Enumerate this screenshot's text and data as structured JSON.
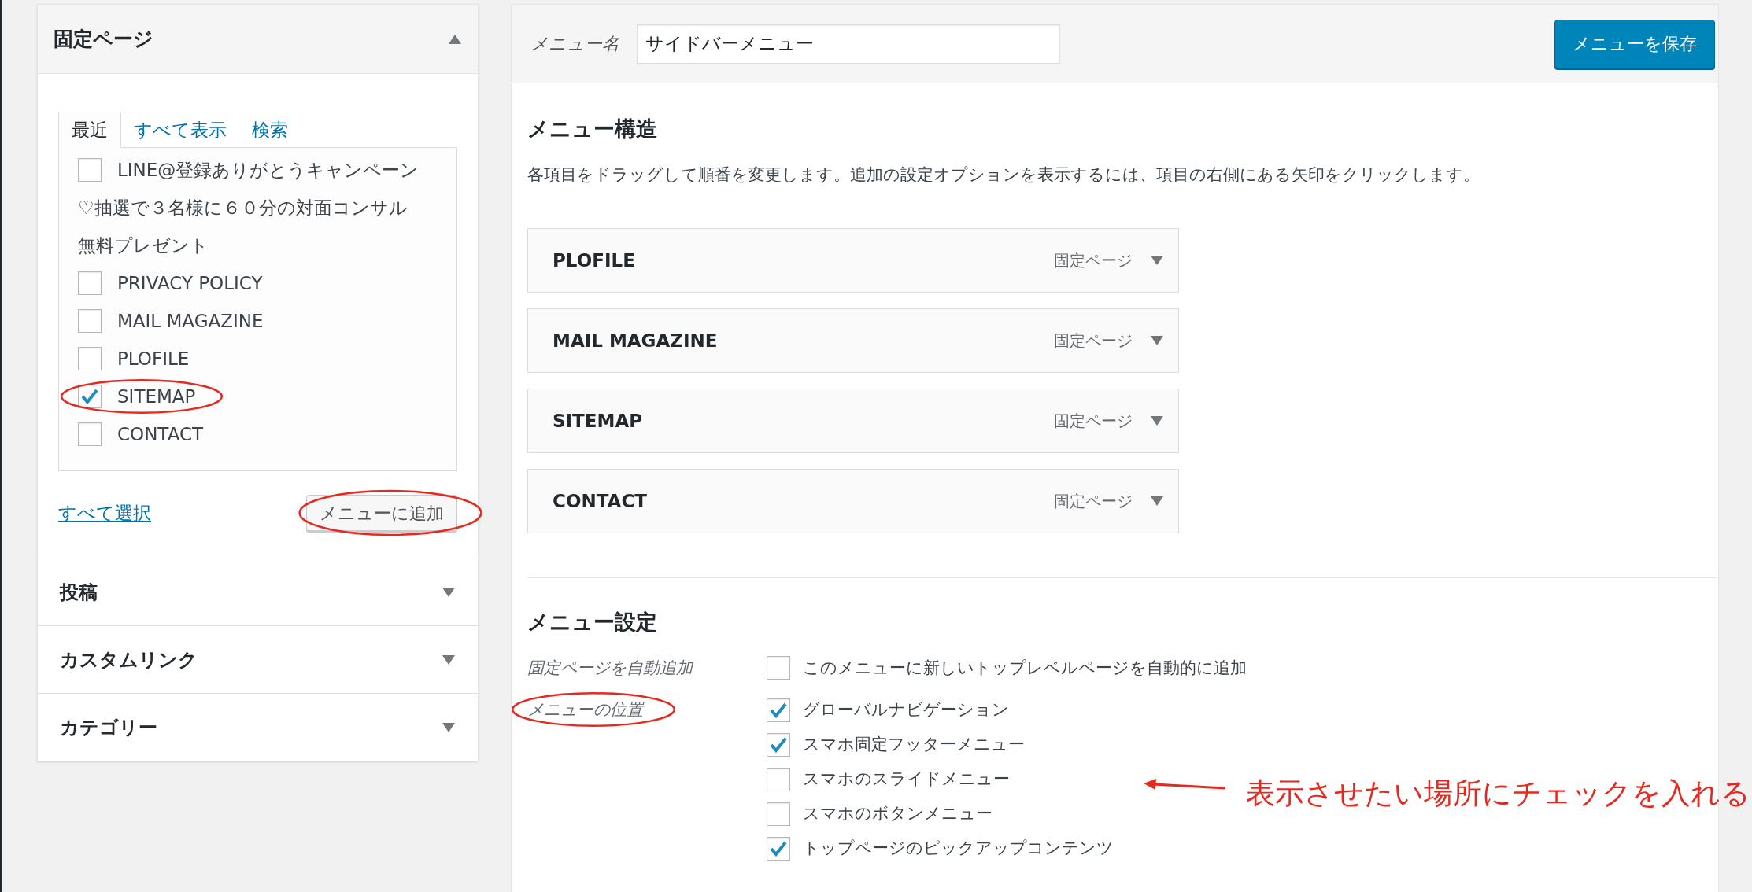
{
  "left_panel": {
    "pages_section": {
      "title": "固定ページ",
      "expanded": true,
      "tabs": [
        {
          "label": "最近",
          "selected": true
        },
        {
          "label": "すべて表示",
          "selected": false
        },
        {
          "label": "検索",
          "selected": false
        }
      ],
      "items": [
        {
          "label_lines": [
            "LINE@登録ありがとうキャンペーン",
            "♡抽選で３名様に６０分の対面コンサル",
            "無料プレゼント"
          ],
          "checked": false,
          "circled": false
        },
        {
          "label_lines": [
            "PRIVACY POLICY"
          ],
          "checked": false,
          "circled": false
        },
        {
          "label_lines": [
            "MAIL MAGAZINE"
          ],
          "checked": false,
          "circled": false
        },
        {
          "label_lines": [
            "PLOFILE"
          ],
          "checked": false,
          "circled": false
        },
        {
          "label_lines": [
            "SITEMAP"
          ],
          "checked": true,
          "circled": true
        },
        {
          "label_lines": [
            "CONTACT"
          ],
          "checked": false,
          "circled": false
        }
      ],
      "select_all_link": "すべて選択",
      "add_button": {
        "label": "メニューに追加",
        "circled": true
      }
    },
    "collapsed_sections": [
      {
        "title": "投稿",
        "expanded": false
      },
      {
        "title": "カスタムリンク",
        "expanded": false
      },
      {
        "title": "カテゴリー",
        "expanded": false
      }
    ]
  },
  "menu_editor": {
    "name_label": "メニュー名",
    "name_value": "サイドバーメニュー",
    "save_button": "メニューを保存",
    "structure": {
      "title": "メニュー構造",
      "description": "各項目をドラッグして順番を変更します。追加の設定オプションを表示するには、項目の右側にある矢印をクリックします。",
      "items": [
        {
          "title": "PLOFILE",
          "type": "固定ページ"
        },
        {
          "title": "MAIL MAGAZINE",
          "type": "固定ページ"
        },
        {
          "title": "SITEMAP",
          "type": "固定ページ"
        },
        {
          "title": "CONTACT",
          "type": "固定ページ"
        }
      ]
    },
    "settings": {
      "title": "メニュー設定",
      "auto_add": {
        "label": "固定ページを自動追加",
        "option": {
          "label": "このメニューに新しいトップレベルページを自動的に追加",
          "checked": false
        }
      },
      "locations": {
        "label": "メニューの位置",
        "circled": true,
        "options": [
          {
            "label": "グローバルナビゲーション",
            "checked": true
          },
          {
            "label": "スマホ固定フッターメニュー",
            "checked": true
          },
          {
            "label": "スマホのスライドメニュー",
            "checked": false
          },
          {
            "label": "スマホのボタンメニュー",
            "checked": false
          },
          {
            "label": "トップページのピックアップコンテンツ",
            "checked": true
          }
        ]
      }
    }
  },
  "annotation": {
    "text": "表示させたい場所にチェックを入れる"
  }
}
